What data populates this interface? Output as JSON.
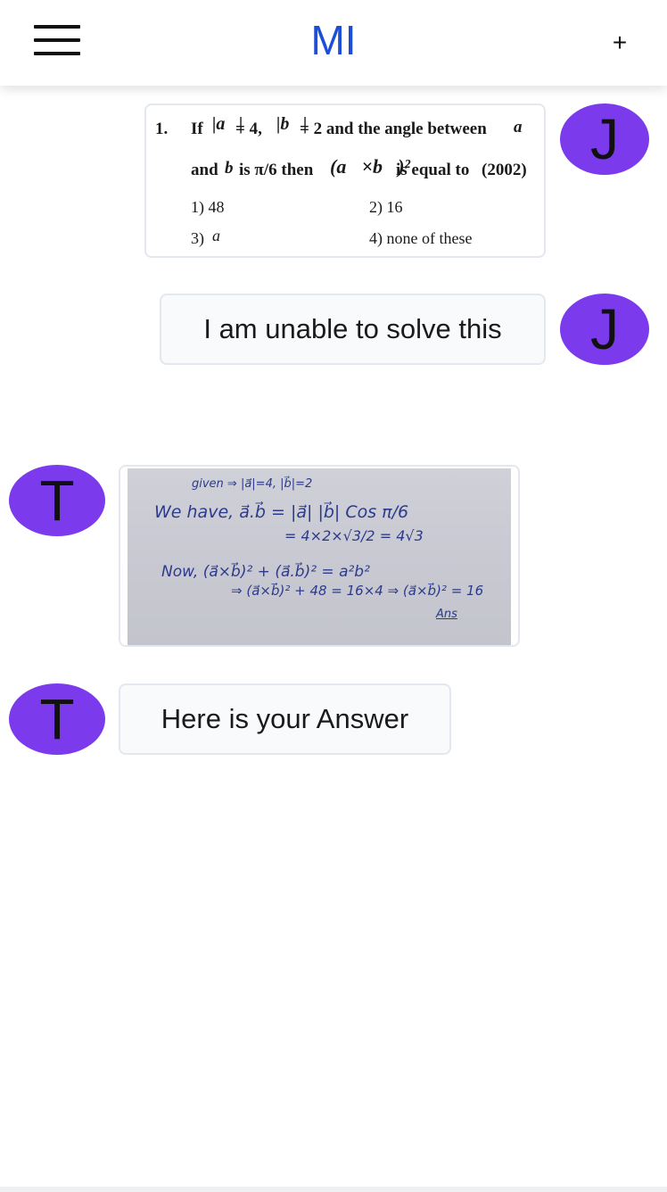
{
  "header": {
    "logo": "MI",
    "add_label": "+"
  },
  "messages": [
    {
      "sender_initial": "J",
      "type": "image",
      "question": {
        "number": "1.",
        "line1_a": "If",
        "line1_b": "= 4,",
        "line1_c": "= 2 and the angle between",
        "line2_a": "and",
        "line2_b": "is π/6 then",
        "line2_c": "is equal to",
        "year": "(2002)",
        "options": [
          "1) 48",
          "2) 16",
          "3)",
          "4) none of these"
        ]
      }
    },
    {
      "sender_initial": "J",
      "type": "text",
      "text": "I am unable to solve this"
    },
    {
      "sender_initial": "T",
      "type": "image",
      "solution_lines": [
        "given ⇒ |a⃗|=4, |b⃗|=2",
        "We have, a⃗.b⃗ = |a⃗| |b⃗| Cos π/6",
        "= 4×2×√3/2 = 4√3",
        "Now, (a⃗×b⃗)² + (a⃗.b⃗)² = a²b²",
        "⇒ (a⃗×b⃗)² + 48 = 16×4 ⇒ (a⃗×b⃗)² = 16",
        "Ans"
      ]
    },
    {
      "sender_initial": "T",
      "type": "text",
      "text": "Here is your Answer"
    }
  ],
  "colors": {
    "accent": "#7c3aed",
    "logo": "#1d4ed8",
    "bubble_bg": "#f8fafc",
    "bubble_border": "#e3e8ee"
  },
  "icons": [
    "hamburger-menu-icon",
    "plus-icon"
  ]
}
